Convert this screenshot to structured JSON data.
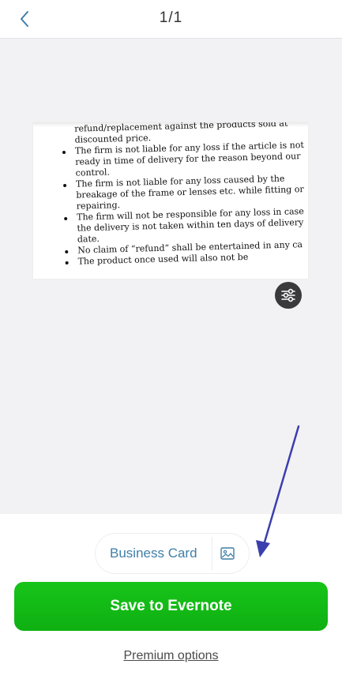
{
  "header": {
    "back_icon": "chevron-left-icon",
    "page_indicator": "1/1"
  },
  "document": {
    "lines": [
      "refund/replacement against the products sold at",
      "discounted price.",
      "The firm is not liable for any loss if the article is not",
      "ready in time of delivery for the reason beyond our",
      "control.",
      "The firm is not liable for any loss caused by the",
      "breakage of the frame or lenses etc. while fitting or",
      "repairing.",
      "The firm will not be responsible for any loss in case",
      "the delivery is not taken within ten days of delivery",
      "date.",
      "No claim of “refund” shall be entertained in any ca",
      "The product once used will also not be"
    ],
    "adjust_icon": "sliders-icon"
  },
  "controls": {
    "mode_label": "Business Card",
    "image_mode_icon": "image-icon",
    "save_label": "Save to Evernote",
    "premium_label": "Premium options"
  },
  "colors": {
    "accent_blue": "#3f7fa8",
    "save_green": "#14bb17",
    "annotation_arrow": "#3b3fae"
  }
}
